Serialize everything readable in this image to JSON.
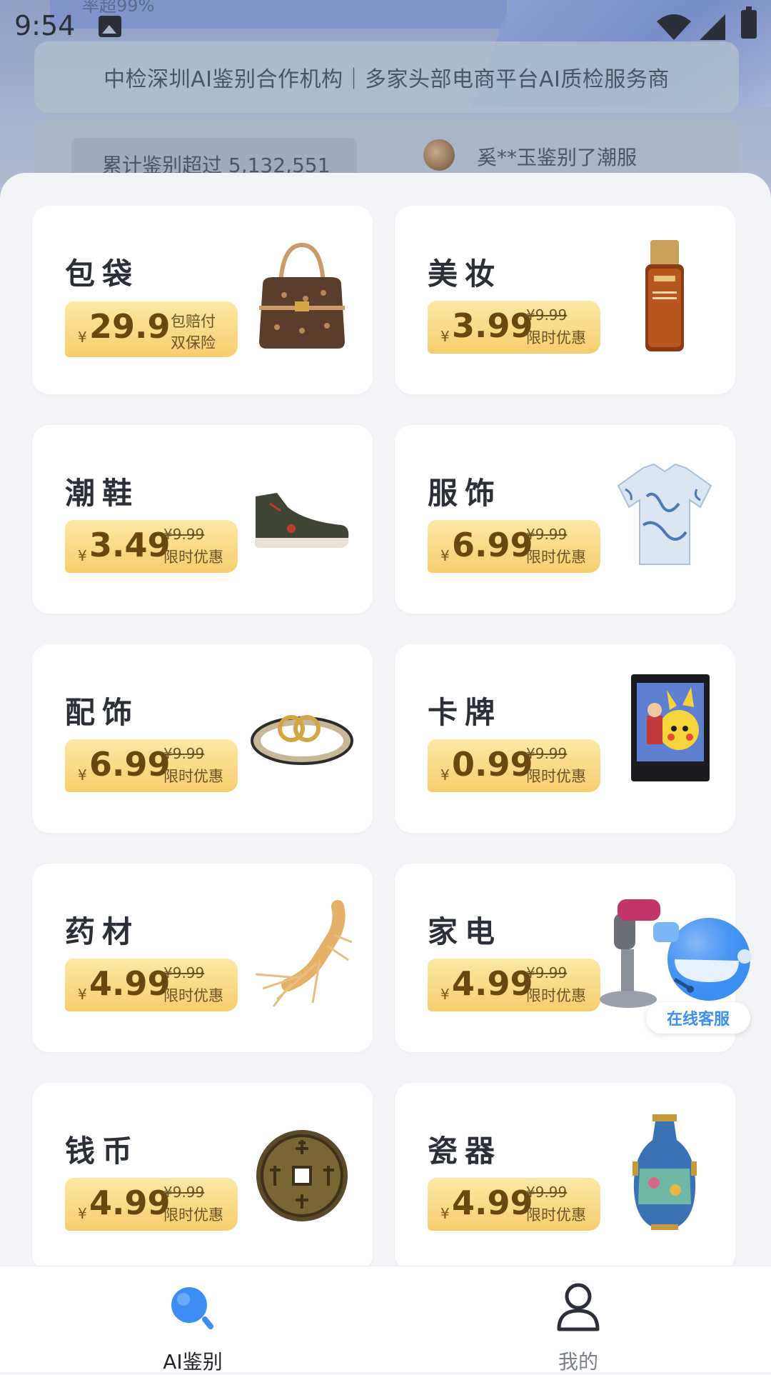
{
  "status_bar": {
    "time": "9:54"
  },
  "background": {
    "banner_text": "率超99%",
    "notice": "中检深圳AI鉴别合作机构｜多家头部电商平台AI质检服务商",
    "stats_text": "累计鉴别超过 5,132,551",
    "recent_user_text": "奚**玉鉴别了潮服"
  },
  "categories": [
    {
      "name": "包袋",
      "currency": "¥",
      "price": "29.9",
      "badge_line1": "包赔付",
      "badge_line2": "双保险",
      "image": "handbag"
    },
    {
      "name": "美妆",
      "currency": "¥",
      "price": "3.99",
      "original_price": "¥9.99",
      "promo": "限时优惠",
      "image": "serum-bottle"
    },
    {
      "name": "潮鞋",
      "currency": "¥",
      "price": "3.49",
      "original_price": "¥9.99",
      "promo": "限时优惠",
      "image": "sneaker"
    },
    {
      "name": "服饰",
      "currency": "¥",
      "price": "6.99",
      "original_price": "¥9.99",
      "promo": "限时优惠",
      "image": "shirt"
    },
    {
      "name": "配饰",
      "currency": "¥",
      "price": "6.99",
      "original_price": "¥9.99",
      "promo": "限时优惠",
      "image": "belt"
    },
    {
      "name": "卡牌",
      "currency": "¥",
      "price": "0.99",
      "original_price": "¥9.99",
      "promo": "限时优惠",
      "image": "trading-card"
    },
    {
      "name": "药材",
      "currency": "¥",
      "price": "4.99",
      "original_price": "¥9.99",
      "promo": "限时优惠",
      "image": "ginseng"
    },
    {
      "name": "家电",
      "currency": "¥",
      "price": "4.99",
      "original_price": "¥9.99",
      "promo": "限时优惠",
      "image": "hair-dryer"
    },
    {
      "name": "钱币",
      "currency": "¥",
      "price": "4.99",
      "original_price": "¥9.99",
      "promo": "限时优惠",
      "image": "ancient-coin"
    },
    {
      "name": "瓷器",
      "currency": "¥",
      "price": "4.99",
      "original_price": "¥9.99",
      "promo": "限时优惠",
      "image": "porcelain-vase"
    }
  ],
  "support": {
    "label": "在线客服"
  },
  "bottom_nav": {
    "items": [
      {
        "label": "AI鉴别",
        "icon": "search-icon",
        "active": true
      },
      {
        "label": "我的",
        "icon": "profile-icon",
        "active": false
      }
    ]
  },
  "colors": {
    "accent": "#3d8ef2",
    "price_tag": "#f6cd6c",
    "price_text": "#6b4710"
  }
}
